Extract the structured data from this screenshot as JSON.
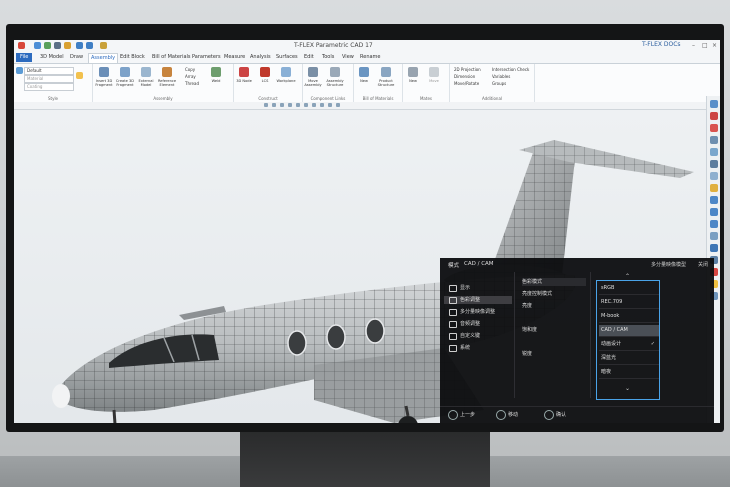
{
  "app": {
    "title": "T-FLEX Parametric CAD 17",
    "brand": "T-FLEX DOCs",
    "tabs": [
      "File",
      "3D Model",
      "Draw",
      "Assembly",
      "Edit Block",
      "Bill of Materials",
      "Parameters",
      "Measure",
      "Analysis",
      "Surfaces",
      "Edit",
      "Tools",
      "View",
      "Rename"
    ],
    "active_tab": "Assembly"
  },
  "ribbon": {
    "style_group": {
      "label": "Style",
      "combo1": "Default",
      "combo2": "Material",
      "combo3": "Coating"
    },
    "assembly_group": {
      "label": "Assembly",
      "buttons": [
        "Insert 3D Fragment",
        "Create 3D Fragment",
        "External Model",
        "Reference Element"
      ],
      "small": [
        "Copy",
        "Array",
        "Thread",
        "Weld"
      ]
    },
    "construct_group": {
      "label": "Construct",
      "buttons": [
        "3D Node",
        "LCS",
        "Workplane"
      ]
    },
    "component_links_group": {
      "label": "Component Links",
      "buttons": [
        "Move Assembly",
        "Assembly Structure"
      ]
    },
    "bom_group": {
      "label": "Bill of Materials",
      "buttons": [
        "New",
        "Product Structure"
      ]
    },
    "mates_group": {
      "label": "Mates",
      "buttons": [
        "New",
        "Move"
      ]
    },
    "additional_group": {
      "label": "Additional",
      "items": [
        "2D Projection",
        "Dimension",
        "Move/Rotate",
        "Intersection Check",
        "Variables",
        "Groups"
      ]
    }
  },
  "osd": {
    "mode_label": "模式",
    "preset": "CAD / CAM",
    "model": "多分量映像模型",
    "close": "关闭",
    "menu": [
      "显示",
      "色彩调整",
      "多分量映像调整",
      "音频调整",
      "自定义键",
      "系统"
    ],
    "submenu": [
      "色彩模式",
      "亮度控制模式",
      "亮度",
      "",
      "饱和度",
      "",
      "锐度"
    ],
    "options": [
      "sRGB",
      "REC.709",
      "M-book",
      "CAD / CAM",
      "动画设计",
      "深蓝光",
      "暗夜"
    ],
    "selected_option": "CAD / CAM",
    "checked_option": "动画设计",
    "footer": [
      "上一步",
      "移动",
      "确认"
    ],
    "accent": "#4aa3e8"
  }
}
